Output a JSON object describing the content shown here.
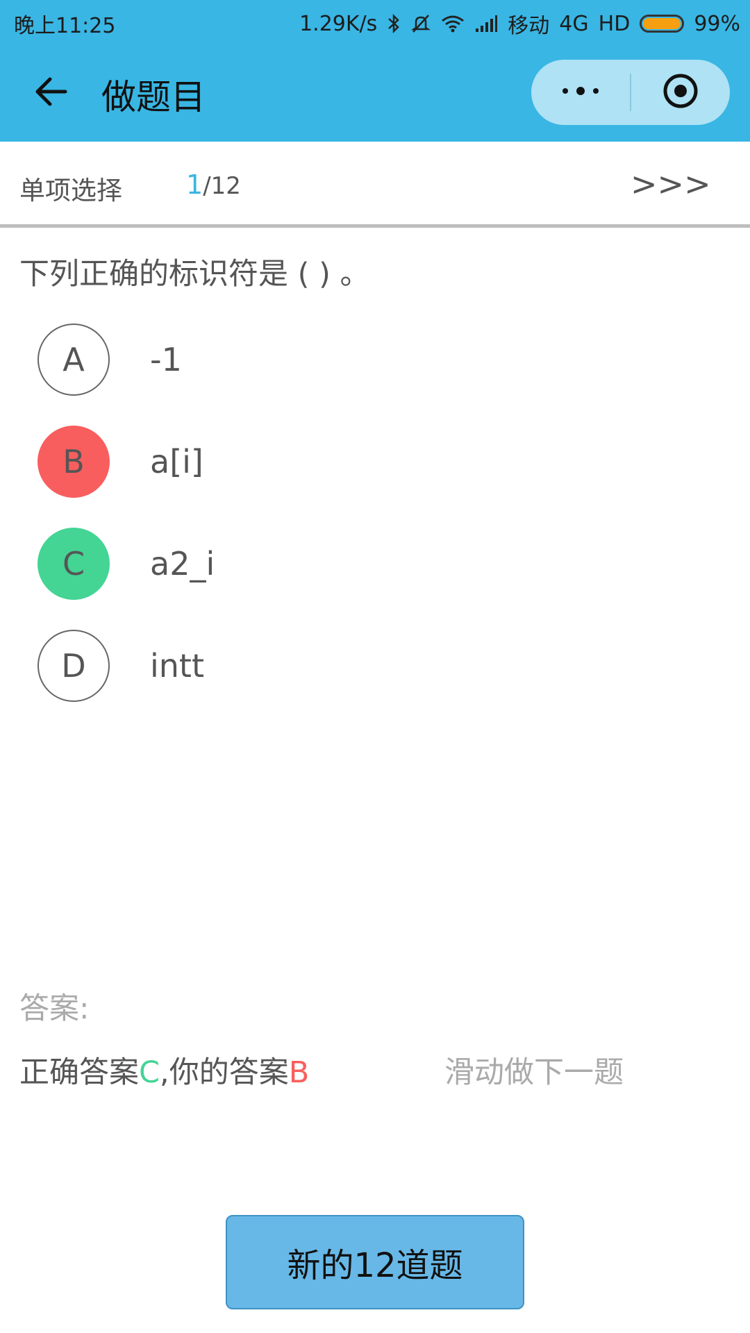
{
  "status_bar": {
    "time": "晚上11:25",
    "speed": "1.29K/s",
    "carrier": "移动",
    "network": "4G",
    "hd": "HD",
    "battery": "99%",
    "icons": [
      "bluetooth-icon",
      "mute-icon",
      "wifi-icon",
      "signal-icon",
      "battery-icon"
    ]
  },
  "nav": {
    "title": "做题目",
    "back_icon": "arrow-left-icon",
    "menu_icon": "more-dots-icon",
    "close_icon": "record-circle-icon"
  },
  "question_bar": {
    "type": "单项选择",
    "current": "1",
    "total": "/12",
    "next": ">>>"
  },
  "question": {
    "text": "下列正确的标识符是 ( ) 。",
    "options": [
      {
        "letter": "A",
        "text": "-1",
        "state": "none"
      },
      {
        "letter": "B",
        "text": "a[i]",
        "state": "wrong"
      },
      {
        "letter": "C",
        "text": "a2_i",
        "state": "correct"
      },
      {
        "letter": "D",
        "text": "intt",
        "state": "none"
      }
    ]
  },
  "answer": {
    "label": "答案:",
    "correct_prefix": "正确答案",
    "correct_letter": "C",
    "yours_prefix": ",你的答案",
    "yours_letter": "B",
    "swipe_hint": "滑动做下一题"
  },
  "footer": {
    "button_label": "新的12道题"
  },
  "colors": {
    "primary": "#39b6e4",
    "wrong": "#f95e5e",
    "correct": "#44d494",
    "button": "#67b8e6"
  }
}
